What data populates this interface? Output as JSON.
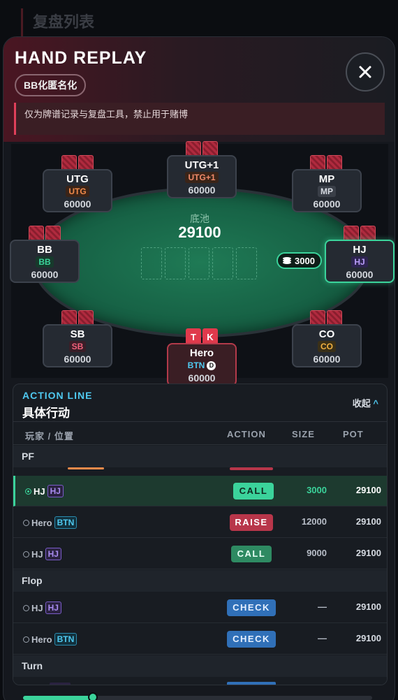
{
  "background": {
    "title": "复盘列表"
  },
  "modal": {
    "title": "HAND REPLAY",
    "anon_badge": "BB化匿名化",
    "warning": "仅为牌谱记录与复盘工具，禁止用于赌博"
  },
  "table": {
    "pot_label": "底池",
    "pot_value": "29100",
    "bet_chip": "3000",
    "seats": {
      "utg": {
        "name": "UTG",
        "pos": "UTG",
        "stack": "60000"
      },
      "utg1": {
        "name": "UTG+1",
        "pos": "UTG+1",
        "stack": "60000"
      },
      "mp": {
        "name": "MP",
        "pos": "MP",
        "stack": "60000"
      },
      "bb": {
        "name": "BB",
        "pos": "BB",
        "stack": "60000"
      },
      "hj": {
        "name": "HJ",
        "pos": "HJ",
        "stack": "60000"
      },
      "sb": {
        "name": "SB",
        "pos": "SB",
        "stack": "60000"
      },
      "co": {
        "name": "CO",
        "pos": "CO",
        "stack": "60000"
      },
      "hero": {
        "name": "Hero",
        "pos": "BTN",
        "dealer": "D",
        "stack": "60000",
        "cards": [
          "T",
          "K"
        ]
      }
    }
  },
  "actions": {
    "subtitle": "ACTION LINE",
    "title": "具体行动",
    "collapse": "收起",
    "collapse_icon": "^",
    "headers": {
      "player": "玩家 / 位置",
      "action": "ACTION",
      "size": "SIZE",
      "pot": "POT"
    },
    "sections": {
      "pf": "PF",
      "flop": "Flop",
      "turn": "Turn"
    },
    "rows": [
      {
        "player": "HJ",
        "pos": "HJ",
        "action": "CALL",
        "size": "3000",
        "pot": "29100"
      },
      {
        "player": "Hero",
        "pos": "BTN",
        "action": "RAISE",
        "size": "12000",
        "pot": "29100"
      },
      {
        "player": "HJ",
        "pos": "HJ",
        "action": "CALL",
        "size": "9000",
        "pot": "29100"
      },
      {
        "player": "HJ",
        "pos": "HJ",
        "action": "CHECK",
        "size": "—",
        "pot": "29100"
      },
      {
        "player": "Hero",
        "pos": "BTN",
        "action": "CHECK",
        "size": "—",
        "pot": "29100"
      }
    ]
  },
  "replay_progress": 0.2,
  "colors": {
    "accent": "#3bd39b",
    "danger": "#e0405a",
    "info": "#4fc9f0"
  }
}
